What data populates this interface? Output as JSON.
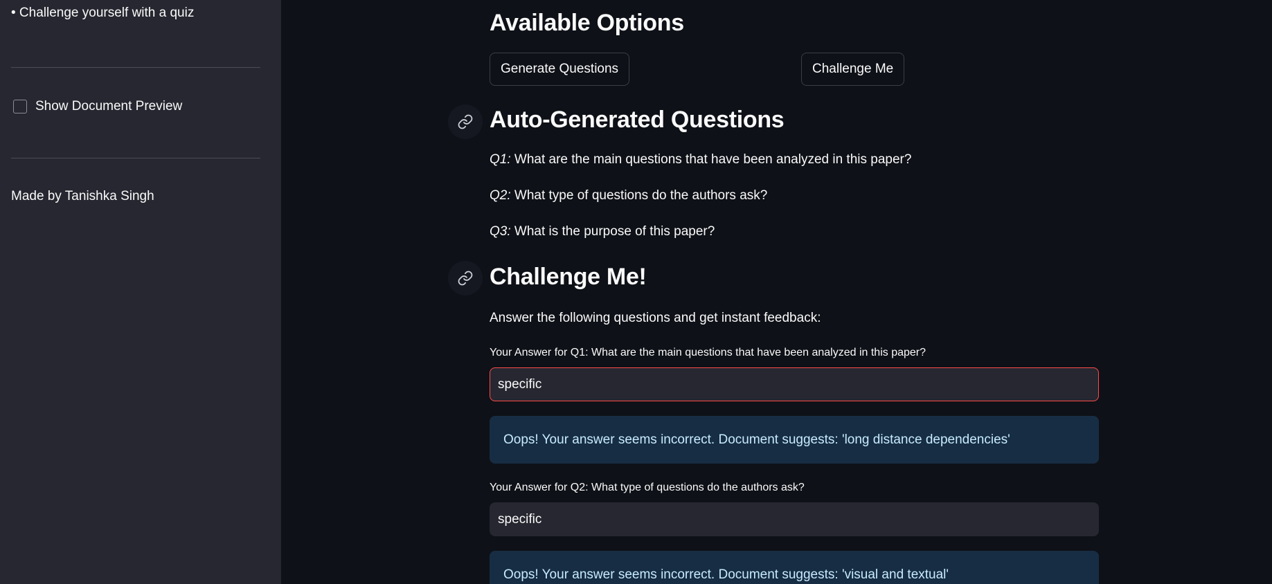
{
  "sidebar": {
    "bullet_item": "• Challenge yourself with a quiz",
    "preview_checkbox_label": "Show Document Preview",
    "footer": "Made by Tanishka Singh"
  },
  "options": {
    "heading": "Available Options",
    "generate_button": "Generate Questions",
    "challenge_button": "Challenge Me"
  },
  "auto_questions": {
    "heading": "Auto-Generated Questions",
    "items": [
      {
        "prefix": "Q1:",
        "text": " What are the main questions that have been analyzed in this paper?"
      },
      {
        "prefix": "Q2:",
        "text": " What type of questions do the authors ask?"
      },
      {
        "prefix": "Q3:",
        "text": " What is the purpose of this paper?"
      }
    ]
  },
  "challenge": {
    "heading": "Challenge Me!",
    "intro": "Answer the following questions and get instant feedback:",
    "answers": [
      {
        "label": "Your Answer for Q1: What are the main questions that have been analyzed in this paper?",
        "value": "specific",
        "feedback": "Oops! Your answer seems incorrect. Document suggests: 'long distance dependencies'"
      },
      {
        "label": "Your Answer for Q2: What type of questions do the authors ask?",
        "value": "specific",
        "feedback": "Oops! Your answer seems incorrect. Document suggests: 'visual and textual'"
      }
    ]
  },
  "colors": {
    "sidebar_bg": "#262730",
    "main_bg": "#0e1117",
    "input_bg": "#262730",
    "invalid_border": "#ff4b4b",
    "info_bg": "#172d43",
    "info_text": "#c7ebff"
  },
  "icons": {
    "anchor": "link-icon"
  }
}
